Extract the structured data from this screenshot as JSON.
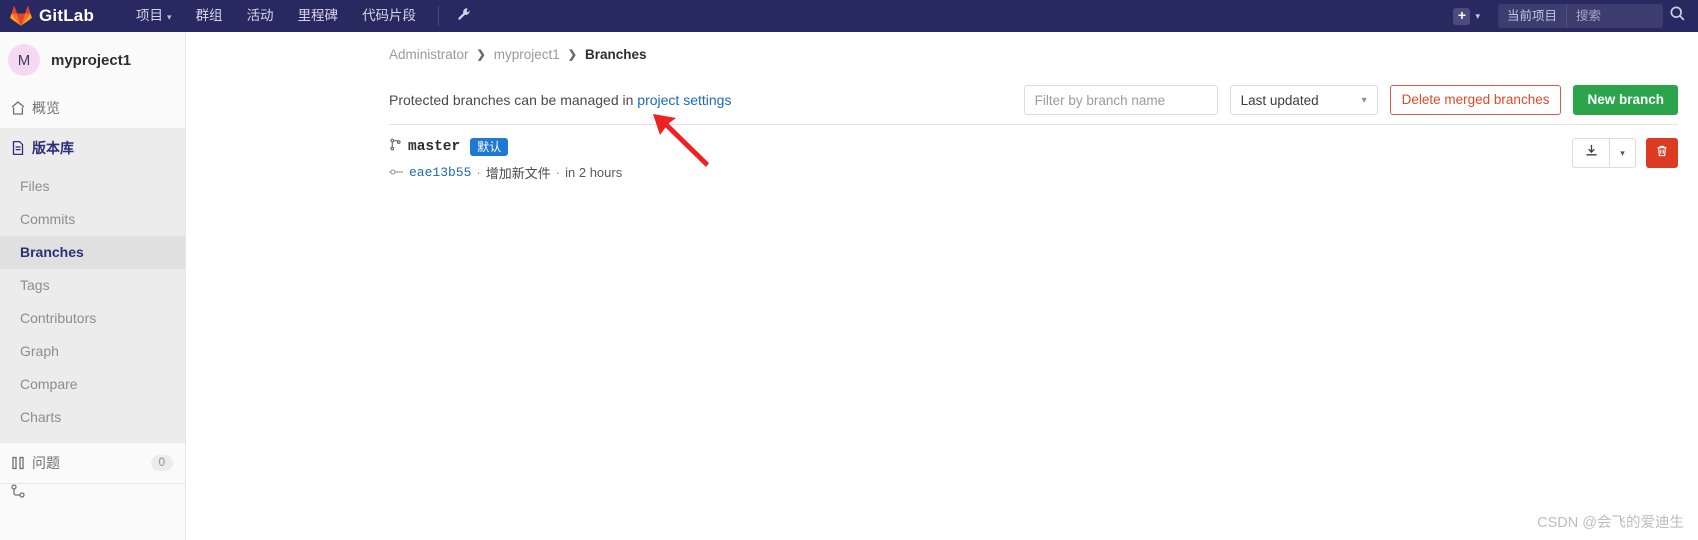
{
  "navbar": {
    "brand": "GitLab",
    "logo_icon": "gitlab-tanuki-icon",
    "links": [
      {
        "label": "项目",
        "has_caret": true
      },
      {
        "label": "群组",
        "has_caret": false
      },
      {
        "label": "活动",
        "has_caret": false
      },
      {
        "label": "里程碑",
        "has_caret": false
      },
      {
        "label": "代码片段",
        "has_caret": false
      }
    ],
    "wrench_icon": "wrench-icon",
    "plus_icon": "plus-icon",
    "plus_caret_icon": "chevron-down-icon",
    "search_scope": "当前项目",
    "search_placeholder": "搜索",
    "search_value": "",
    "search_icon": "search-icon"
  },
  "sidebar": {
    "project_avatar_letter": "M",
    "project_name": "myproject1",
    "items": [
      {
        "label": "概览",
        "icon": "home-icon"
      },
      {
        "label": "版本库",
        "icon": "document-icon"
      }
    ],
    "repo_subitems": [
      {
        "label": "Files"
      },
      {
        "label": "Commits"
      },
      {
        "label": "Branches"
      },
      {
        "label": "Tags"
      },
      {
        "label": "Contributors"
      },
      {
        "label": "Graph"
      },
      {
        "label": "Compare"
      },
      {
        "label": "Charts"
      }
    ],
    "issues": {
      "label": "问题",
      "icon": "issue-icon",
      "count": "0"
    }
  },
  "breadcrumb": {
    "items": [
      "Administrator",
      "myproject1"
    ],
    "current": "Branches",
    "separator": "❯"
  },
  "toolbar": {
    "notice_prefix": "Protected branches can be managed in",
    "notice_link": "project settings",
    "filter_placeholder": "Filter by branch name",
    "filter_value": "",
    "sort_value": "Last updated",
    "sort_caret_icon": "chevron-down-icon",
    "delete_merged_label": "Delete merged branches",
    "new_branch_label": "New branch"
  },
  "branches": [
    {
      "name": "master",
      "badge": "默认",
      "branch_icon": "branch-icon",
      "commit_icon": "commit-icon",
      "sha": "eae13b55",
      "message": "增加新文件",
      "time": "in 2 hours",
      "separator": "·",
      "download_icon": "download-icon",
      "download_caret_icon": "chevron-down-icon",
      "delete_icon": "trash-icon"
    }
  ],
  "annotation": {
    "arrow_icon": "red-arrow-icon",
    "color": "#ee2222"
  },
  "watermark": "CSDN @会飞的爱迪生",
  "colors": {
    "navbar_bg": "#292961",
    "accent_blue": "#1b69b6",
    "success_green": "#2ca44b",
    "danger_red": "#db3b21",
    "badge_blue": "#1f78d1",
    "sidebar_bg": "#fafafa"
  }
}
